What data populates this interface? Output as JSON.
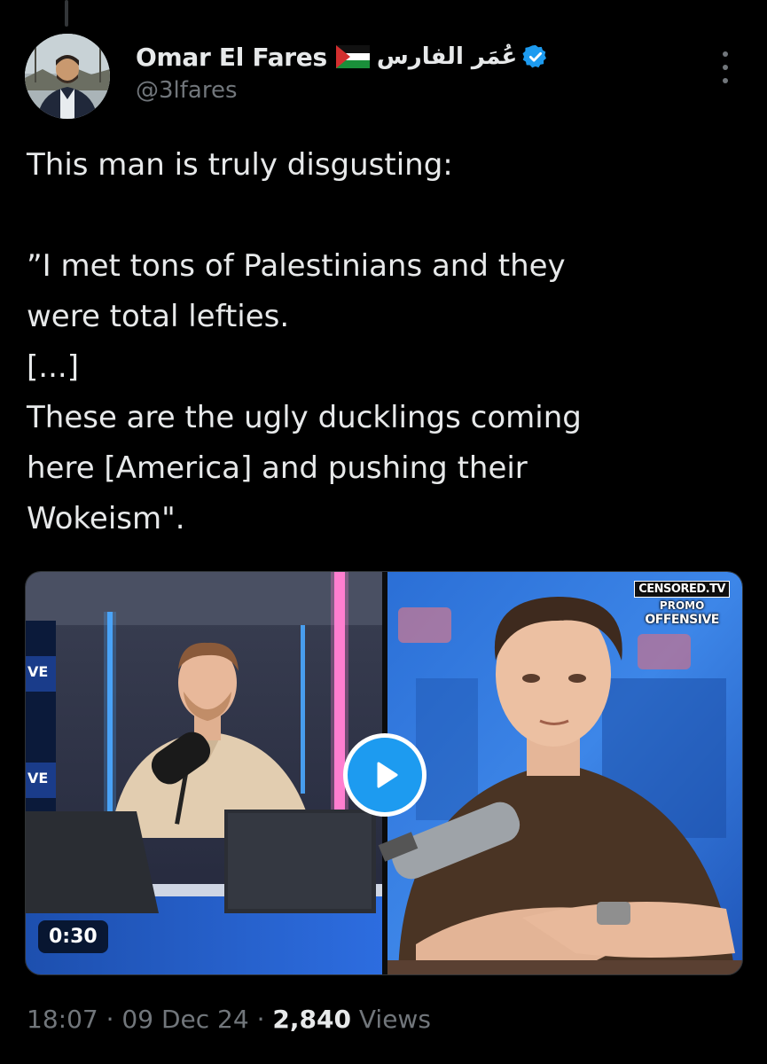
{
  "tweet": {
    "author": {
      "display_name": "Omar El Fares",
      "arabic_name": "عُمَر الفارس",
      "handle": "@3lfares",
      "verified": true,
      "flag_icon": "palestine-flag-icon",
      "avatar_icon": "avatar"
    },
    "text_lines": [
      "This man is truly disgusting:",
      "",
      "”I met tons of Palestinians and they",
      "were total lefties.",
      "[...]",
      "These are the ugly ducklings coming",
      "here [America] and pushing their",
      "Wokeism\"."
    ],
    "media": {
      "type": "video",
      "duration": "0:30",
      "watermark": {
        "line1": "CENSORED.TV",
        "line2": "PROMO",
        "line3": "OFFENSIVE"
      },
      "set_text": "VE"
    },
    "meta": {
      "time": "18:07",
      "separator": "·",
      "date": "09 Dec 24",
      "views_count": "2,840",
      "views_label": "Views"
    }
  },
  "colors": {
    "background": "#000000",
    "text_primary": "#e7e9ea",
    "text_secondary": "#71767b",
    "accent": "#1d9bf0"
  }
}
